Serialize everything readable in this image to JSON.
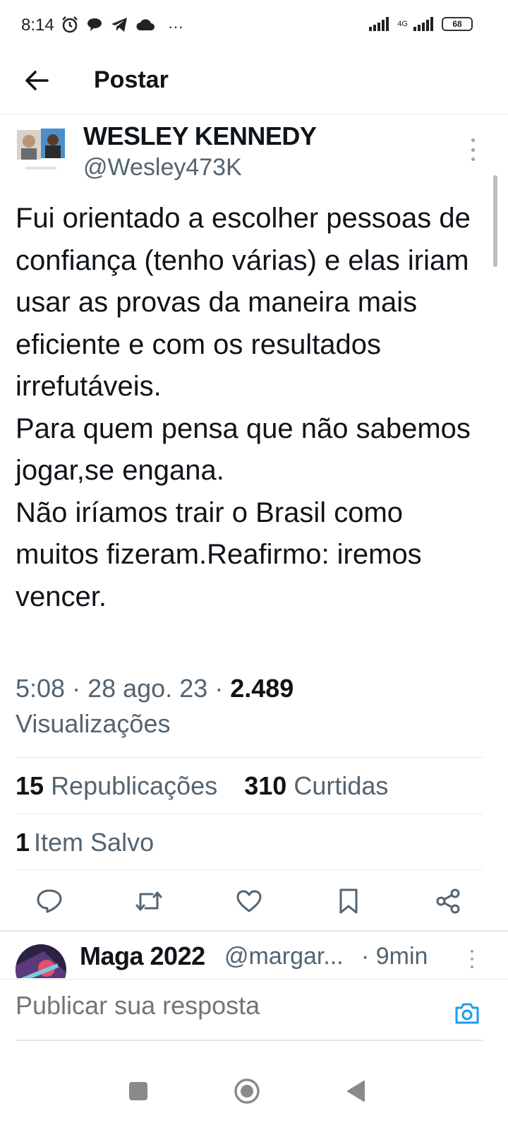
{
  "status_bar": {
    "time": "8:14",
    "more_indicator": "···",
    "network_label": "4G",
    "battery": "68",
    "icons": [
      "alarm-icon",
      "chat-icon",
      "telegram-icon",
      "cloud-icon"
    ]
  },
  "header": {
    "title": "Postar",
    "back_icon": "arrow-left-icon"
  },
  "post": {
    "author_name": "WESLEY KENNEDY",
    "author_handle": "@Wesley473K",
    "text": "Fui orientado a escolher pessoas de confiança (tenho várias) e elas iriam usar as provas da maneira mais eficiente e com os resultados irrefutáveis.\nPara quem pensa que não sabemos jogar,se engana.\nNão iríamos trair o Brasil como muitos fizeram.Reafirmo: iremos vencer.",
    "time": "5:08",
    "date": "28 ago. 23",
    "sep": " · ",
    "views_count": "2.489",
    "views_label": "Visualizações",
    "reposts_count": "15",
    "reposts_label": "Republicações",
    "likes_count": "310",
    "likes_label": "Curtidas",
    "saves_count": "1",
    "saves_label": "Item Salvo"
  },
  "actions": [
    "reply-icon",
    "repost-icon",
    "like-icon",
    "bookmark-icon",
    "share-icon"
  ],
  "reply_preview": {
    "name": "Maga 2022",
    "handle": "@margar...",
    "time": "· 9min"
  },
  "composer": {
    "placeholder": "Publicar sua resposta"
  },
  "colors": {
    "accent": "#1d9bf0",
    "text_primary": "#0f1419",
    "text_secondary": "#536471",
    "divider": "#e6e6e6"
  }
}
